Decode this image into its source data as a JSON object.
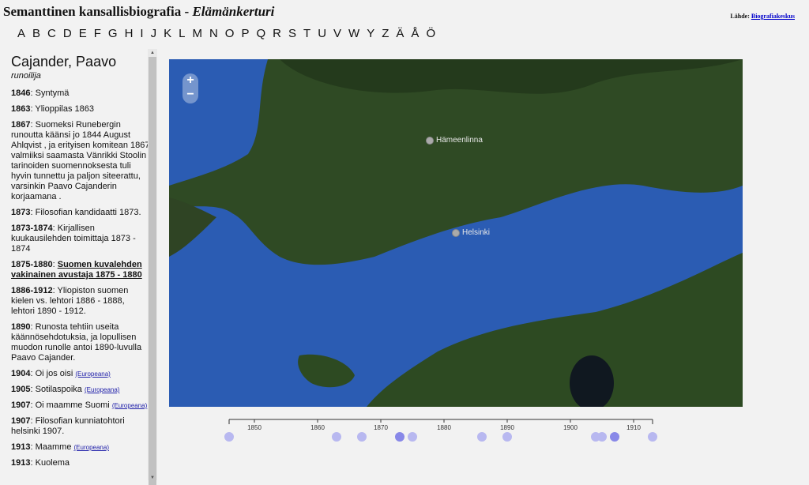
{
  "header": {
    "title_main": "Semanttinen kansallisbiografia",
    "title_sep": " - ",
    "title_sub": "Elämänkerturi",
    "source_label": "Lähde:",
    "source_link": "Biografiakeskus"
  },
  "alphabet": [
    "A",
    "B",
    "C",
    "D",
    "E",
    "F",
    "G",
    "H",
    "I",
    "J",
    "K",
    "L",
    "M",
    "N",
    "O",
    "P",
    "Q",
    "R",
    "S",
    "T",
    "U",
    "V",
    "W",
    "Y",
    "Z",
    "Ä",
    "Å",
    "Ö"
  ],
  "person": {
    "name": "Cajander, Paavo",
    "title": "runoilija"
  },
  "events": [
    {
      "year": "1846",
      "text": "Syntymä",
      "link": ""
    },
    {
      "year": "1863",
      "text": "Ylioppilas 1863",
      "link": ""
    },
    {
      "year": "1867",
      "text": "Suomeksi Runebergin runoutta käänsi jo 1844 August Ahlqvist , ja erityisen komitean 1867 valmiiksi saamasta Vänrikki Stoolin tarinoiden suomennoksesta tuli hyvin tunnettu ja paljon siteerattu, varsinkin Paavo Cajanderin korjaamana .",
      "link": ""
    },
    {
      "year": "1873",
      "text": "Filosofian kandidaatti 1873.",
      "link": ""
    },
    {
      "year": "1873-1874",
      "text": "Kirjallisen kuukausilehden toimittaja 1873 - 1874",
      "link": ""
    },
    {
      "year": "1875-1880",
      "text": "Suomen kuvalehden vakinainen avustaja 1875 - 1880",
      "link": "",
      "highlight": true
    },
    {
      "year": "1886-1912",
      "text": "Yliopiston suomen kielen vs. lehtori 1886 - 1888, lehtori 1890 - 1912.",
      "link": ""
    },
    {
      "year": "1890",
      "text": "Runosta tehtiin useita käännösehdotuksia, ja lopullisen muodon runolle antoi 1890-luvulla Paavo Cajander.",
      "link": ""
    },
    {
      "year": "1904",
      "text": "Oi jos oisi",
      "link": "(Europeana)"
    },
    {
      "year": "1905",
      "text": "Sotilaspoika",
      "link": "(Europeana)"
    },
    {
      "year": "1907",
      "text": "Oi maamme Suomi",
      "link": "(Europeana)"
    },
    {
      "year": "1907",
      "text": "Filosofian kunniatohtori helsinki 1907.",
      "link": ""
    },
    {
      "year": "1913",
      "text": "Maamme",
      "link": "(Europeana)"
    },
    {
      "year": "1913",
      "text": "Kuolema",
      "link": ""
    }
  ],
  "map": {
    "zoom_in": "+",
    "zoom_out": "−",
    "cities": [
      {
        "name": "Hämeenlinna"
      },
      {
        "name": "Helsinki"
      }
    ]
  },
  "timeline": {
    "start": 1846,
    "end": 1913,
    "ticks": [
      1850,
      1860,
      1870,
      1880,
      1890,
      1900,
      1910
    ],
    "events": [
      {
        "year": 1846,
        "selected": false
      },
      {
        "year": 1863,
        "selected": false
      },
      {
        "year": 1867,
        "selected": false
      },
      {
        "year": 1873,
        "selected": true
      },
      {
        "year": 1875,
        "selected": false
      },
      {
        "year": 1886,
        "selected": false
      },
      {
        "year": 1890,
        "selected": false
      },
      {
        "year": 1904,
        "selected": false
      },
      {
        "year": 1905,
        "selected": false
      },
      {
        "year": 1907,
        "selected": true
      },
      {
        "year": 1913,
        "selected": false
      }
    ],
    "colors": {
      "normal": "#b8b8f0",
      "selected": "#8888e8",
      "axis": "#333333"
    }
  }
}
